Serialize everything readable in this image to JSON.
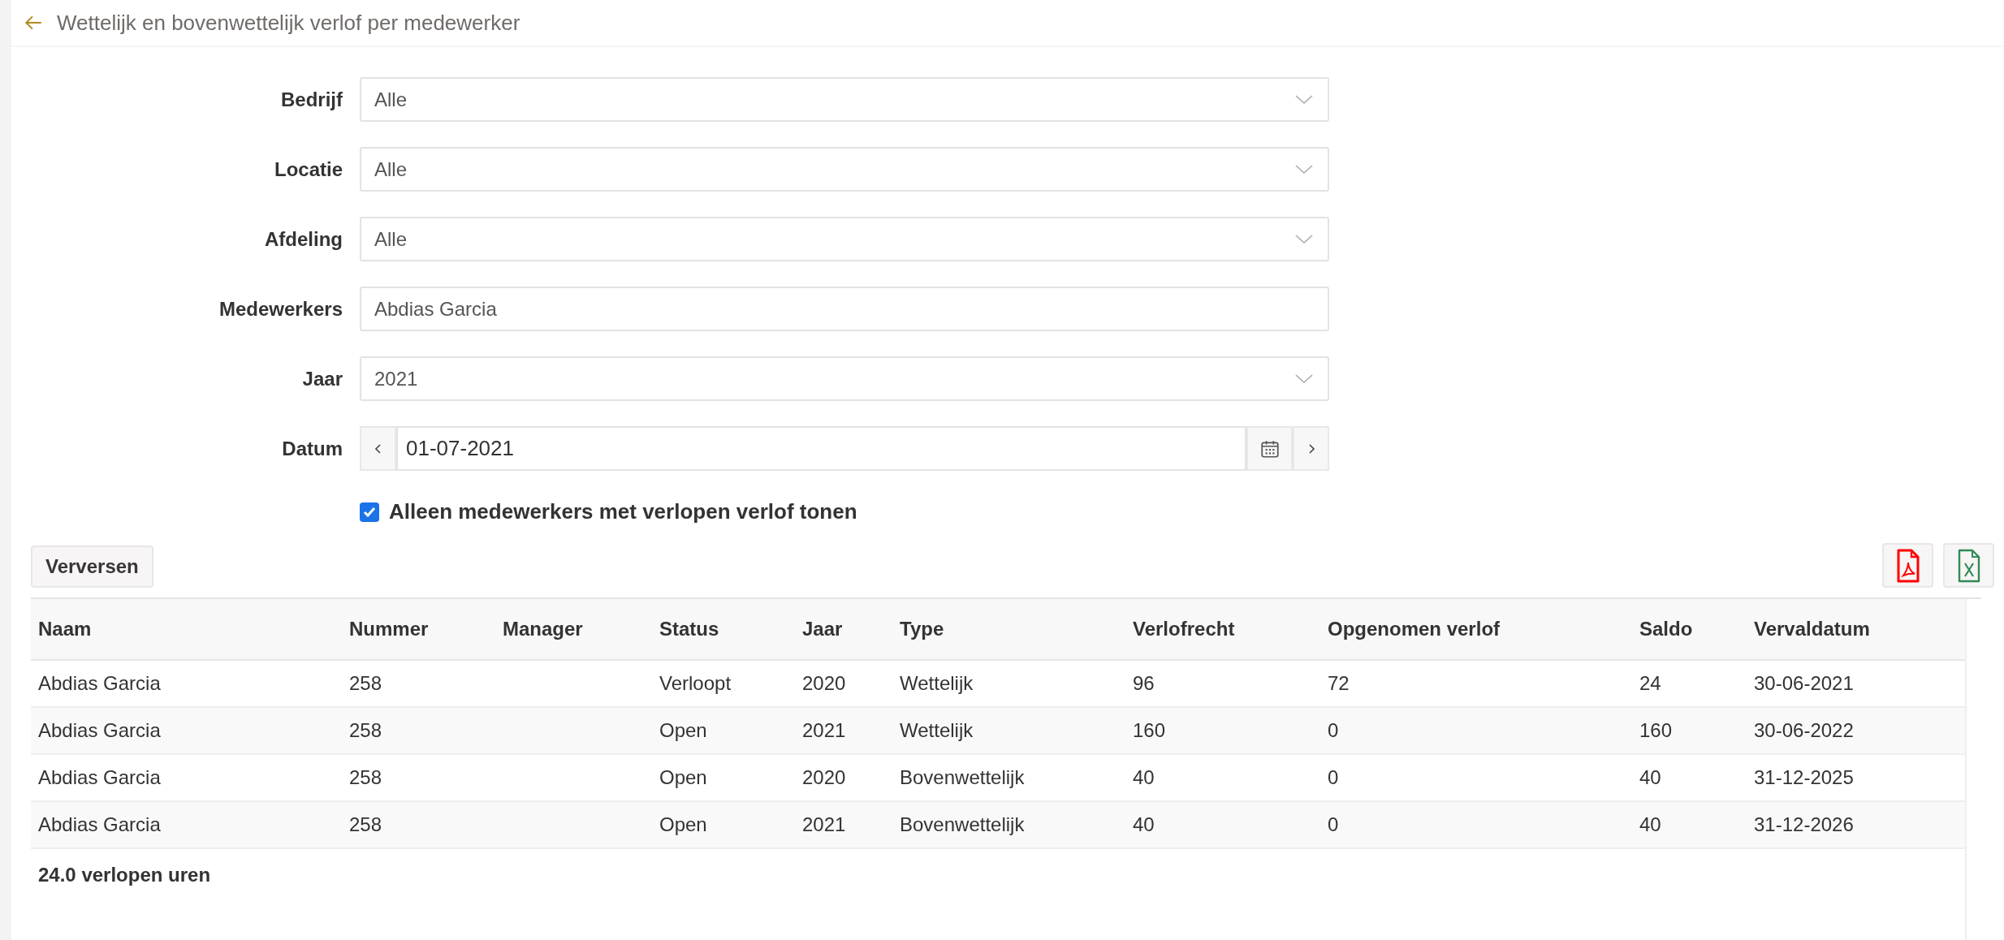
{
  "header": {
    "title": "Wettelijk en bovenwettelijk verlof per medewerker"
  },
  "filters": [
    {
      "kind": "select",
      "label": "Bedrijf",
      "value": "Alle"
    },
    {
      "kind": "select",
      "label": "Locatie",
      "value": "Alle"
    },
    {
      "kind": "select",
      "label": "Afdeling",
      "value": "Alle"
    },
    {
      "kind": "text",
      "label": "Medewerkers",
      "value": "Abdias Garcia"
    },
    {
      "kind": "select",
      "label": "Jaar",
      "value": "2021"
    },
    {
      "kind": "date",
      "label": "Datum",
      "value": "01-07-2021"
    }
  ],
  "expired_only": {
    "label": "Alleen medewerkers met verlopen verlof tonen",
    "checked": true
  },
  "refresh_button": "Verversen",
  "table": {
    "columns": [
      "Naam",
      "Nummer",
      "Manager",
      "Status",
      "Jaar",
      "Type",
      "Verlofrecht",
      "Opgenomen verlof",
      "Saldo",
      "Vervaldatum"
    ],
    "rows": [
      [
        "Abdias Garcia",
        "258",
        "",
        "Verloopt",
        "2020",
        "Wettelijk",
        "96",
        "72",
        "24",
        "30-06-2021"
      ],
      [
        "Abdias Garcia",
        "258",
        "",
        "Open",
        "2021",
        "Wettelijk",
        "160",
        "0",
        "160",
        "30-06-2022"
      ],
      [
        "Abdias Garcia",
        "258",
        "",
        "Open",
        "2020",
        "Bovenwettelijk",
        "40",
        "0",
        "40",
        "31-12-2025"
      ],
      [
        "Abdias Garcia",
        "258",
        "",
        "Open",
        "2021",
        "Bovenwettelijk",
        "40",
        "0",
        "40",
        "31-12-2026"
      ]
    ]
  },
  "summary": "24.0 verlopen uren"
}
